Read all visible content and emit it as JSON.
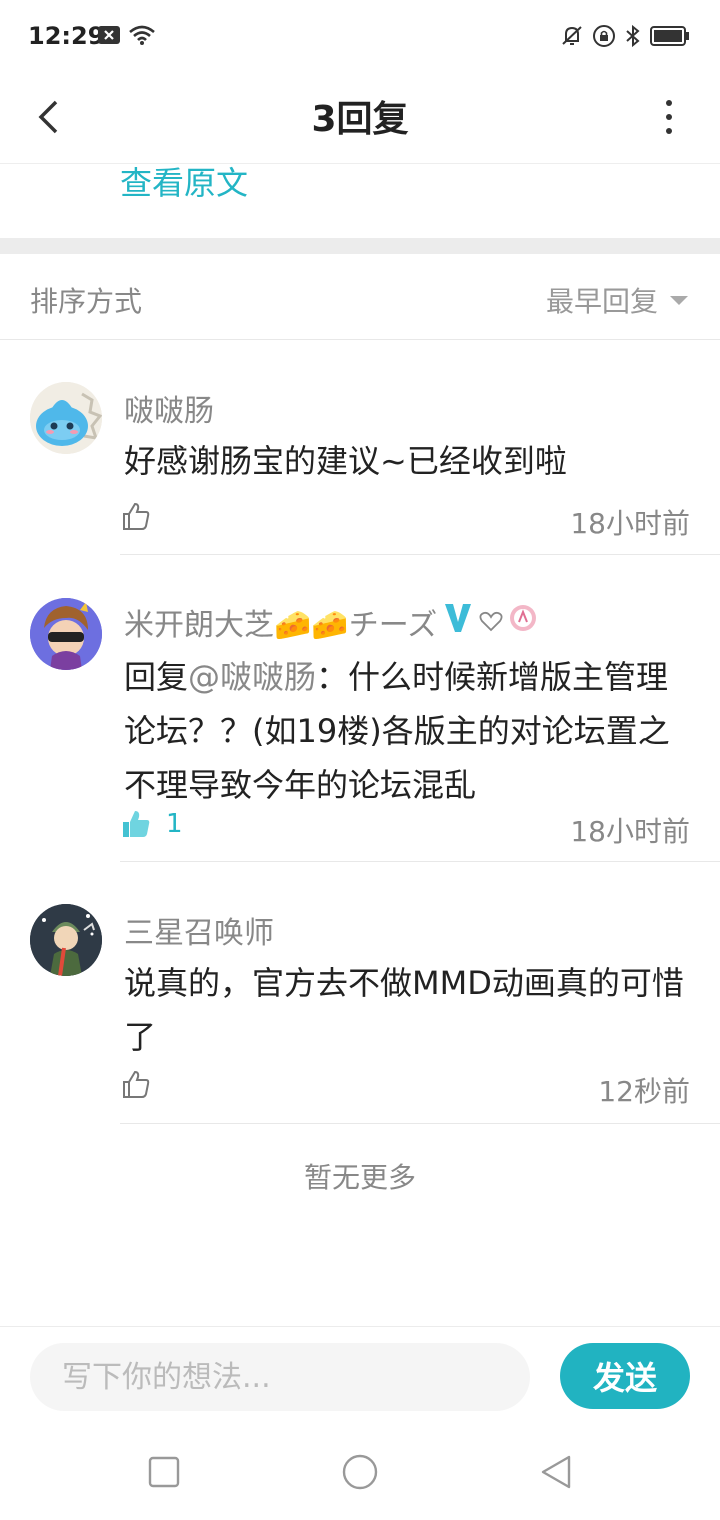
{
  "status": {
    "time": "12:29"
  },
  "header": {
    "title": "3回复"
  },
  "view_original": "查看原文",
  "sort": {
    "label": "排序方式",
    "selected": "最早回复"
  },
  "comments": [
    {
      "user": "啵啵肠",
      "text": "好感谢肠宝的建议~已经收到啦",
      "time": "18小时前",
      "likes": ""
    },
    {
      "user": "米开朗大芝🧀🧀チーズ",
      "reply_prefix": "回复",
      "mention": "@啵啵肠",
      "text": "：什么时候新增版主管理论坛？？(如19楼)各版主的对论坛置之不理导致今年的论坛混乱",
      "time": "18小时前",
      "likes": "1"
    },
    {
      "user": "三星召唤师",
      "text": "说真的，官方去不做MMD动画真的可惜了",
      "time": "12秒前",
      "likes": ""
    }
  ],
  "no_more": "暂无更多",
  "composer": {
    "placeholder": "写下你的想法...",
    "send_label": "发送"
  },
  "colors": {
    "accent": "#21b3c1",
    "muted": "#888888"
  }
}
